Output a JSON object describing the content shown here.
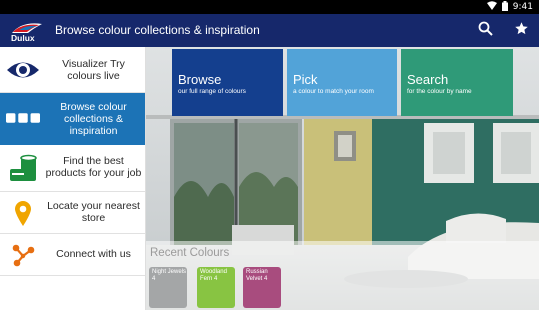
{
  "status_bar": {
    "time": "9:41",
    "icons": [
      "wifi-icon",
      "battery-icon"
    ]
  },
  "app_bar": {
    "logo_text": "Dulux",
    "title": "Browse colour collections & inspiration",
    "actions": [
      "search-icon",
      "star-icon"
    ]
  },
  "sidebar": {
    "items": [
      {
        "label": "Visualizer Try colours live",
        "icon": "eye-icon",
        "active": false
      },
      {
        "label": "Browse colour collections & inspiration",
        "icon": "swatches-icon",
        "active": true
      },
      {
        "label": "Find the best products for your job",
        "icon": "paint-can-icon",
        "active": false
      },
      {
        "label": "Locate your nearest store",
        "icon": "map-pin-icon",
        "active": false
      },
      {
        "label": "Connect with us",
        "icon": "share-icon",
        "active": false
      }
    ]
  },
  "tiles": [
    {
      "title": "Browse",
      "subtitle": "our full range of colours",
      "color": "#143f8e"
    },
    {
      "title": "Pick",
      "subtitle": "a colour to match your room",
      "color": "#52a3d8"
    },
    {
      "title": "Search",
      "subtitle": "for the colour by name",
      "color": "#2f9a78"
    }
  ],
  "recent": {
    "title": "Recent Colours",
    "swatches": [
      {
        "name": "Night Jewels 4",
        "color": "#a4a6a7"
      },
      {
        "name": "Woodland Fern 4",
        "color": "#88c442"
      },
      {
        "name": "Russian Velvet 4",
        "color": "#a84c7e"
      }
    ]
  },
  "colors": {
    "status_bar": "#000000",
    "app_bar": "#16286b",
    "sidebar_active": "#1c73b6",
    "accent_green": "#1d8f3f",
    "accent_orange": "#f0a500"
  }
}
